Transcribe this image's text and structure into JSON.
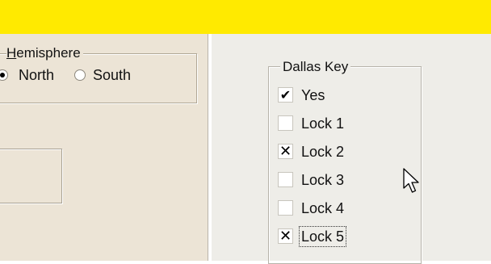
{
  "hemisphere": {
    "title_underlined_char": "H",
    "title_rest": "emisphere",
    "options": [
      {
        "label": "North",
        "selected": true
      },
      {
        "label": "South",
        "selected": false
      }
    ]
  },
  "dallas_key": {
    "title": "Dallas Key",
    "items": [
      {
        "label": "Yes",
        "state": "checked",
        "mark": "✔"
      },
      {
        "label": "Lock 1",
        "state": "unchecked",
        "mark": ""
      },
      {
        "label": "Lock 2",
        "state": "crossed",
        "mark": "✕"
      },
      {
        "label": "Lock 3",
        "state": "unchecked",
        "mark": ""
      },
      {
        "label": "Lock 4",
        "state": "unchecked",
        "mark": ""
      },
      {
        "label": "Lock 5",
        "state": "crossed",
        "mark": "✕",
        "focused": true
      }
    ]
  },
  "colors": {
    "banner": "#ffea00",
    "left_panel": "#ece4d6",
    "right_panel": "#eeede8"
  }
}
